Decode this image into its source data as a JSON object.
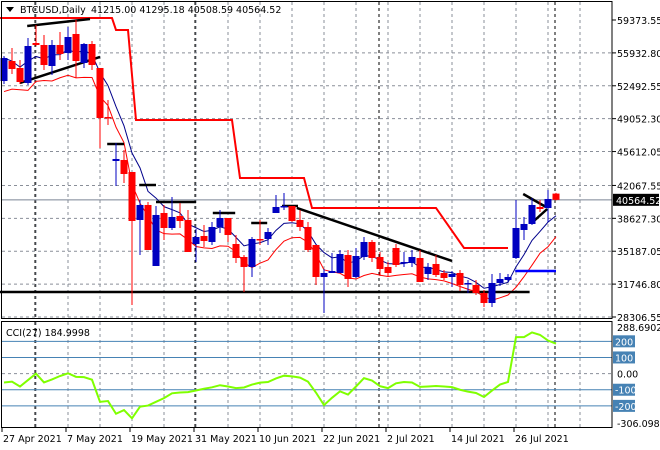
{
  "header": {
    "symbol": "BTCUSD,Daily",
    "ohlc": "41215.00 41295.18 40508.59 40564.52"
  },
  "chart_data": {
    "type": "candlestick",
    "title": "BTCUSD,Daily",
    "colors": {
      "up": "#0000c0",
      "down": "#ff0000",
      "cci": "#7fff00",
      "ma_fast": "#00008b",
      "ma_slow": "#ff0000",
      "stop_line": "#ff0000",
      "level_line": "#4682b4"
    },
    "price_axis": {
      "ticks": [
        "59373.55",
        "55932.80",
        "52492.55",
        "49052.30",
        "45612.05",
        "42067.55",
        "38627.30",
        "35187.05",
        "31746.80",
        "28306.55"
      ],
      "ylim": [
        28306.55,
        59373.55
      ]
    },
    "current_price": "40564.52",
    "date_labels": [
      {
        "bar": 0,
        "label": "27 Apr 2021"
      },
      {
        "bar": 8,
        "label": "7 May 2021"
      },
      {
        "bar": 16,
        "label": "19 May 2021"
      },
      {
        "bar": 24,
        "label": "31 May 2021"
      },
      {
        "bar": 32,
        "label": "10 Jun 2021"
      },
      {
        "bar": 40,
        "label": "22 Jun 2021"
      },
      {
        "bar": 48,
        "label": "2 Jul 2021"
      },
      {
        "bar": 56,
        "label": "14 Jul 2021"
      },
      {
        "bar": 64,
        "label": "26 Jul 2021"
      }
    ],
    "period_separators": [
      4,
      24,
      47,
      69
    ],
    "candles": [
      [
        52993,
        55608,
        52679,
        55399
      ],
      [
        55085,
        56445,
        53726,
        54249
      ],
      [
        54353,
        55190,
        52679,
        52889
      ],
      [
        52784,
        57491,
        52575,
        56654
      ],
      [
        56968,
        58851,
        56654,
        56759
      ],
      [
        56759,
        57805,
        54144,
        54667
      ],
      [
        54562,
        57282,
        53621,
        56759
      ],
      [
        56759,
        58119,
        55190,
        55817
      ],
      [
        55922,
        58642,
        55190,
        57596
      ],
      [
        57910,
        59374,
        53307,
        55085
      ],
      [
        54876,
        56968,
        54353,
        56863
      ],
      [
        56863,
        57177,
        54144,
        54667
      ],
      [
        54353,
        54353,
        45985,
        49123
      ],
      [
        49228,
        51006,
        48391,
        49123
      ],
      [
        44625,
        46508,
        42010,
        44835
      ],
      [
        44730,
        45776,
        42324,
        43266
      ],
      [
        43475,
        43475,
        29563,
        38349
      ],
      [
        38454,
        40546,
        34793,
        40023
      ],
      [
        40023,
        40337,
        35316,
        35316
      ],
      [
        33642,
        39918,
        33642,
        38977
      ],
      [
        39186,
        40023,
        36362,
        37617
      ],
      [
        37617,
        40860,
        37408,
        38768
      ],
      [
        38872,
        40232,
        37617,
        38349
      ],
      [
        38454,
        39500,
        35106,
        35106
      ],
      [
        35943,
        37512,
        34061,
        36675
      ],
      [
        36780,
        37931,
        35629,
        36257
      ],
      [
        36152,
        38244,
        35839,
        37722
      ],
      [
        37722,
        39500,
        37094,
        38663
      ],
      [
        38663,
        38663,
        36152,
        36885
      ],
      [
        35943,
        36885,
        33956,
        34479
      ],
      [
        34583,
        34793,
        30923,
        33538
      ],
      [
        33538,
        36675,
        32492,
        36466
      ],
      [
        36466,
        38454,
        35839,
        36362
      ],
      [
        36466,
        37617,
        35839,
        37198
      ],
      [
        39186,
        41069,
        39186,
        39814
      ],
      [
        39814,
        41278,
        39500,
        39918
      ],
      [
        39918,
        39918,
        38244,
        38349
      ],
      [
        38454,
        39500,
        37303,
        37722
      ],
      [
        37722,
        38244,
        35106,
        35316
      ],
      [
        35839,
        35839,
        31655,
        32492
      ],
      [
        32492,
        33329,
        28727,
        32910
      ],
      [
        32910,
        35002,
        32910,
        33119
      ],
      [
        32910,
        35316,
        32910,
        34897
      ],
      [
        34793,
        35316,
        31446,
        32283
      ],
      [
        32492,
        35525,
        32387,
        34688
      ],
      [
        34583,
        36675,
        34270,
        36152
      ],
      [
        36152,
        36362,
        34061,
        34479
      ],
      [
        34583,
        35106,
        32597,
        33329
      ],
      [
        33538,
        34061,
        32597,
        32910
      ],
      [
        35525,
        35943,
        33538,
        33747
      ],
      [
        33956,
        35106,
        33538,
        34061
      ],
      [
        33956,
        35316,
        33538,
        34583
      ],
      [
        34479,
        35316,
        31969,
        31969
      ],
      [
        32806,
        33956,
        32178,
        33538
      ],
      [
        33852,
        34793,
        32492,
        32701
      ],
      [
        32910,
        33224,
        32178,
        32387
      ],
      [
        32492,
        33119,
        31446,
        32806
      ],
      [
        32910,
        33224,
        31028,
        31655
      ],
      [
        31760,
        32178,
        30818,
        31864
      ],
      [
        31655,
        32178,
        30609,
        30818
      ],
      [
        30818,
        31132,
        29354,
        29772
      ],
      [
        29772,
        32806,
        29354,
        31864
      ],
      [
        31864,
        32910,
        31551,
        32283
      ],
      [
        32178,
        32806,
        31969,
        32492
      ],
      [
        34479,
        40546,
        34374,
        37617
      ],
      [
        37408,
        38768,
        36362,
        38036
      ],
      [
        38036,
        40755,
        37931,
        40023
      ],
      [
        39814,
        40546,
        39291,
        39604
      ],
      [
        39709,
        41592,
        38244,
        40651
      ],
      [
        41215,
        41295.18,
        40508.59,
        40564.52
      ]
    ],
    "stop_line": [
      [
        -0.5,
        59580
      ],
      [
        13.5,
        59580
      ],
      [
        14,
        58330
      ],
      [
        15.5,
        58330
      ],
      [
        16.5,
        48910
      ],
      [
        28.5,
        48910
      ],
      [
        29.5,
        42850
      ],
      [
        37.5,
        42850
      ],
      [
        38.5,
        39710
      ],
      [
        54,
        39710
      ],
      [
        57.5,
        35530
      ],
      [
        63,
        35530
      ]
    ],
    "horizontal_segments": [
      {
        "from": -0.5,
        "to": 65.7,
        "price": 30923,
        "color": "#000000"
      },
      {
        "from": 63.9,
        "to": 69,
        "price": 33119,
        "color": "#0000ff"
      },
      {
        "from": 12.9,
        "to": 15,
        "price": 46404,
        "color": "#000000"
      },
      {
        "from": 16.9,
        "to": 19,
        "price": 42115,
        "color": "#000000"
      },
      {
        "from": 19,
        "to": 24,
        "price": 40337,
        "color": "#000000"
      },
      {
        "from": 26.1,
        "to": 28.9,
        "price": 39186,
        "color": "#000000"
      },
      {
        "from": 30.9,
        "to": 32.9,
        "price": 38140,
        "color": "#000000"
      },
      {
        "from": 34.75,
        "to": 36.75,
        "price": 39918,
        "color": "#000000"
      }
    ],
    "trendlines": [
      [
        [
          2.9,
          58747
        ],
        [
          10.75,
          59478
        ]
      ],
      [
        [
          2,
          52784
        ],
        [
          12,
          55504
        ]
      ],
      [
        [
          36.6,
          39709
        ],
        [
          56,
          34165
        ]
      ],
      [
        [
          64.9,
          41174
        ],
        [
          67.75,
          39814
        ]
      ],
      [
        [
          66.1,
          38244
        ],
        [
          67.9,
          39604
        ]
      ]
    ],
    "cci": {
      "label": "CCI(27) 184.9998",
      "ylim": [
        -306.0986,
        288.6902
      ],
      "axis_labels": {
        "max": "288.6902",
        "min": "-306.0986",
        "zero": "0.00"
      },
      "levels": [
        {
          "value": 200,
          "label": "200"
        },
        {
          "value": 100,
          "label": "100"
        },
        {
          "value": -100,
          "label": "-100"
        },
        {
          "value": -200,
          "label": "-200"
        }
      ],
      "values": [
        -55,
        -50,
        -80,
        -40,
        0,
        -55,
        -36,
        -15,
        2,
        -20,
        -22,
        -38,
        -175,
        -170,
        -249,
        -226,
        -277,
        -205,
        -198,
        -175,
        -152,
        -122,
        -117,
        -115,
        -105,
        -94,
        -85,
        -72,
        -80,
        -90,
        -86,
        -68,
        -56,
        -52,
        -30,
        -13,
        -17,
        -25,
        -50,
        -118,
        -195,
        -150,
        -110,
        -130,
        -80,
        -28,
        -43,
        -78,
        -90,
        -60,
        -52,
        -55,
        -82,
        -80,
        -77,
        -80,
        -84,
        -100,
        -112,
        -120,
        -145,
        -105,
        -68,
        -52,
        226,
        226,
        255,
        240,
        205,
        185
      ]
    }
  }
}
